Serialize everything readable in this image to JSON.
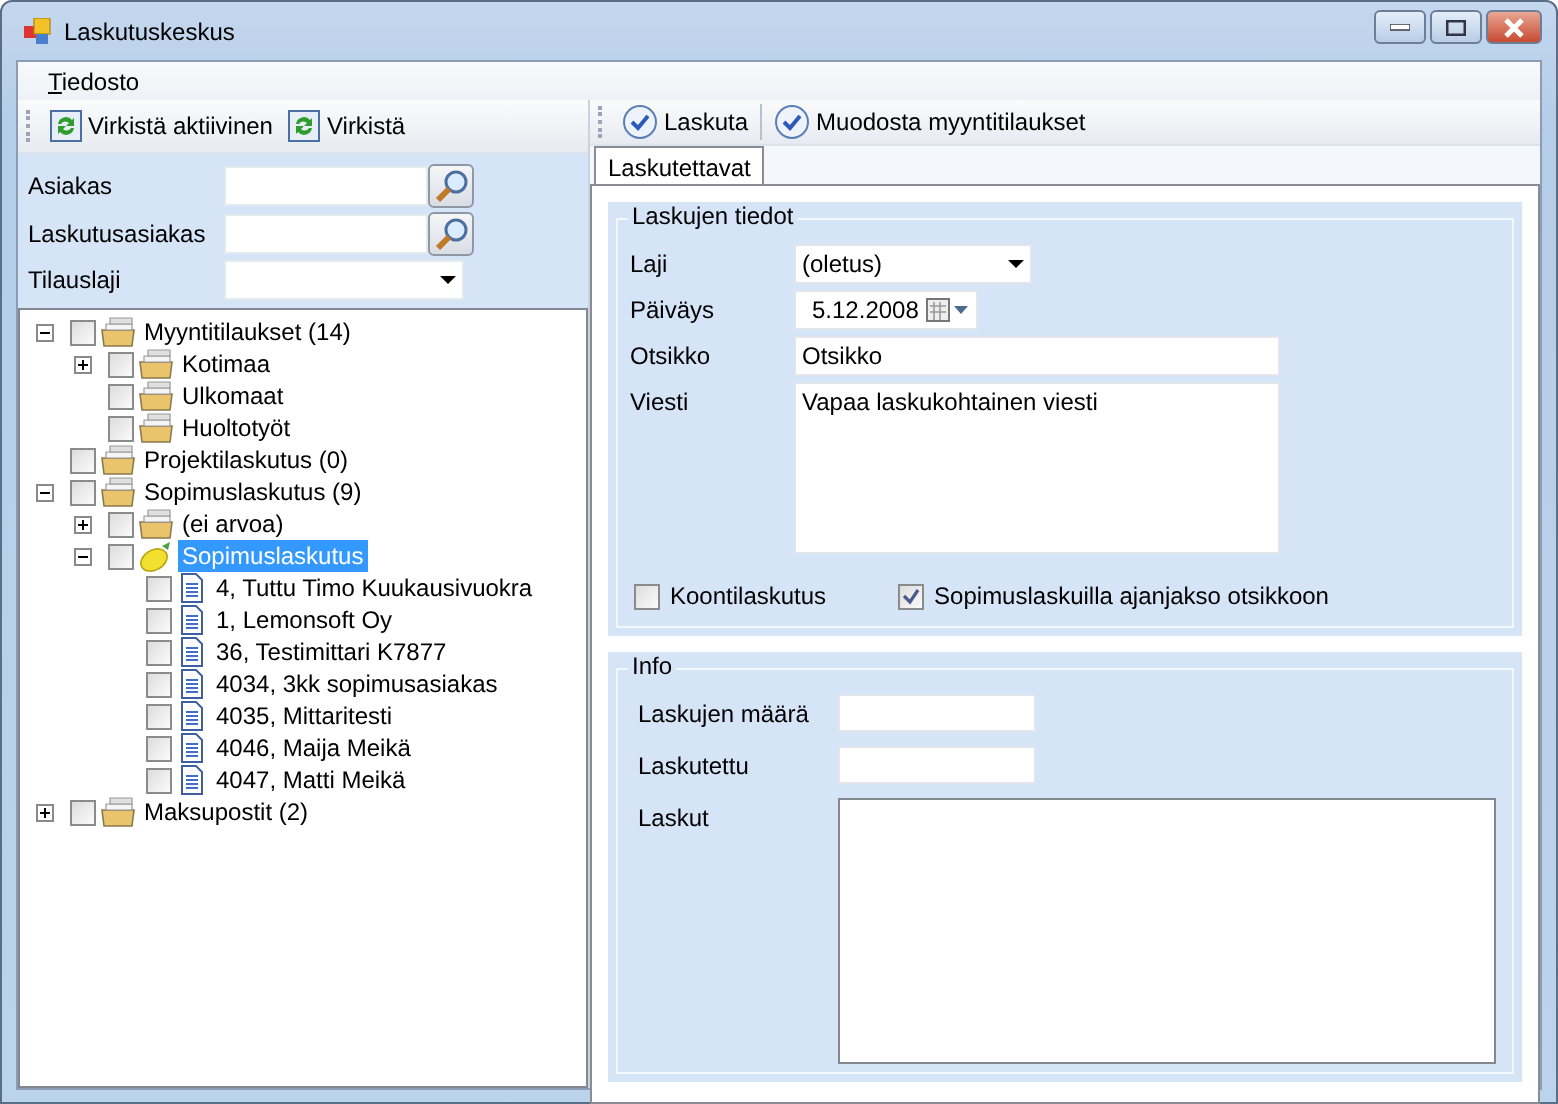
{
  "window": {
    "title": "Laskutuskeskus"
  },
  "menu": [
    {
      "label": "Tiedosto"
    }
  ],
  "left_toolbar": [
    {
      "label": "Virkistä aktiivinen",
      "kind": "refresh"
    },
    {
      "label": "Virkistä",
      "kind": "refresh"
    }
  ],
  "right_toolbar": [
    {
      "label": "Laskuta",
      "kind": "check"
    },
    {
      "label": "Muodosta myyntitilaukset",
      "kind": "check"
    }
  ],
  "filters": [
    {
      "label": "Asiakas",
      "kind": "lookup"
    },
    {
      "label": "Laskutusasiakas",
      "kind": "lookup"
    },
    {
      "label": "Tilauslaji",
      "kind": "dropdown"
    }
  ],
  "tree": [
    {
      "label": "Myyntitilaukset (14)",
      "kind": "folder",
      "checked": false,
      "selected": false,
      "expanded": true,
      "children": [
        {
          "label": "Kotimaa",
          "kind": "folder",
          "checked": false,
          "selected": false,
          "expanded": false
        },
        {
          "label": "Ulkomaat",
          "kind": "folder",
          "checked": false,
          "selected": false
        },
        {
          "label": "Huoltotyöt",
          "kind": "folder",
          "checked": false,
          "selected": false
        }
      ]
    },
    {
      "label": "Projektilaskutus (0)",
      "kind": "folder",
      "checked": false,
      "selected": false
    },
    {
      "label": "Sopimuslaskutus (9)",
      "kind": "folder",
      "checked": false,
      "selected": false,
      "expanded": true,
      "children": [
        {
          "label": "(ei arvoa)",
          "kind": "folder",
          "checked": false,
          "selected": false,
          "expanded": false
        },
        {
          "label": "Sopimuslaskutus",
          "kind": "lemon",
          "checked": false,
          "selected": true,
          "expanded": true,
          "children": [
            {
              "label": "4, Tuttu Timo Kuukausivuokra",
              "kind": "document",
              "checked": false,
              "selected": false
            },
            {
              "label": "1, Lemonsoft Oy",
              "kind": "document",
              "checked": false,
              "selected": false
            },
            {
              "label": "36, Testimittari K7877",
              "kind": "document",
              "checked": false,
              "selected": false
            },
            {
              "label": "4034, 3kk sopimusasiakas",
              "kind": "document",
              "checked": false,
              "selected": false
            },
            {
              "label": "4035, Mittaritesti",
              "kind": "document",
              "checked": false,
              "selected": false
            },
            {
              "label": "4046, Maija Meikä",
              "kind": "document",
              "checked": false,
              "selected": false
            },
            {
              "label": "4047, Matti Meikä",
              "kind": "document",
              "checked": false,
              "selected": false
            }
          ]
        }
      ]
    },
    {
      "label": "Maksupostit (2)",
      "kind": "folder",
      "checked": false,
      "selected": false,
      "expanded": false
    }
  ],
  "tabs": [
    {
      "label": "Laskutettavat",
      "selected": true
    }
  ],
  "invoice_details": {
    "title": "Laskujen tiedot",
    "fields": [
      {
        "label": "Laji",
        "kind": "dropdown",
        "value": "(oletus)"
      },
      {
        "label": "Päiväys",
        "kind": "date",
        "value": "5.12.2008"
      },
      {
        "label": "Otsikko",
        "kind": "text",
        "value": "Otsikko"
      },
      {
        "label": "Viesti",
        "kind": "textarea",
        "value": "Vapaa laskukohtainen viesti"
      }
    ],
    "options": [
      {
        "label": "Koontilaskutus",
        "checked": false
      },
      {
        "label": "Sopimuslaskuilla ajanjakso otsikkoon",
        "checked": true
      }
    ]
  },
  "info": {
    "title": "Info",
    "fields": [
      {
        "label": "Laskujen määrä",
        "kind": "text"
      },
      {
        "label": "Laskutettu",
        "kind": "text"
      },
      {
        "label": "Laskut",
        "kind": "list"
      }
    ]
  }
}
